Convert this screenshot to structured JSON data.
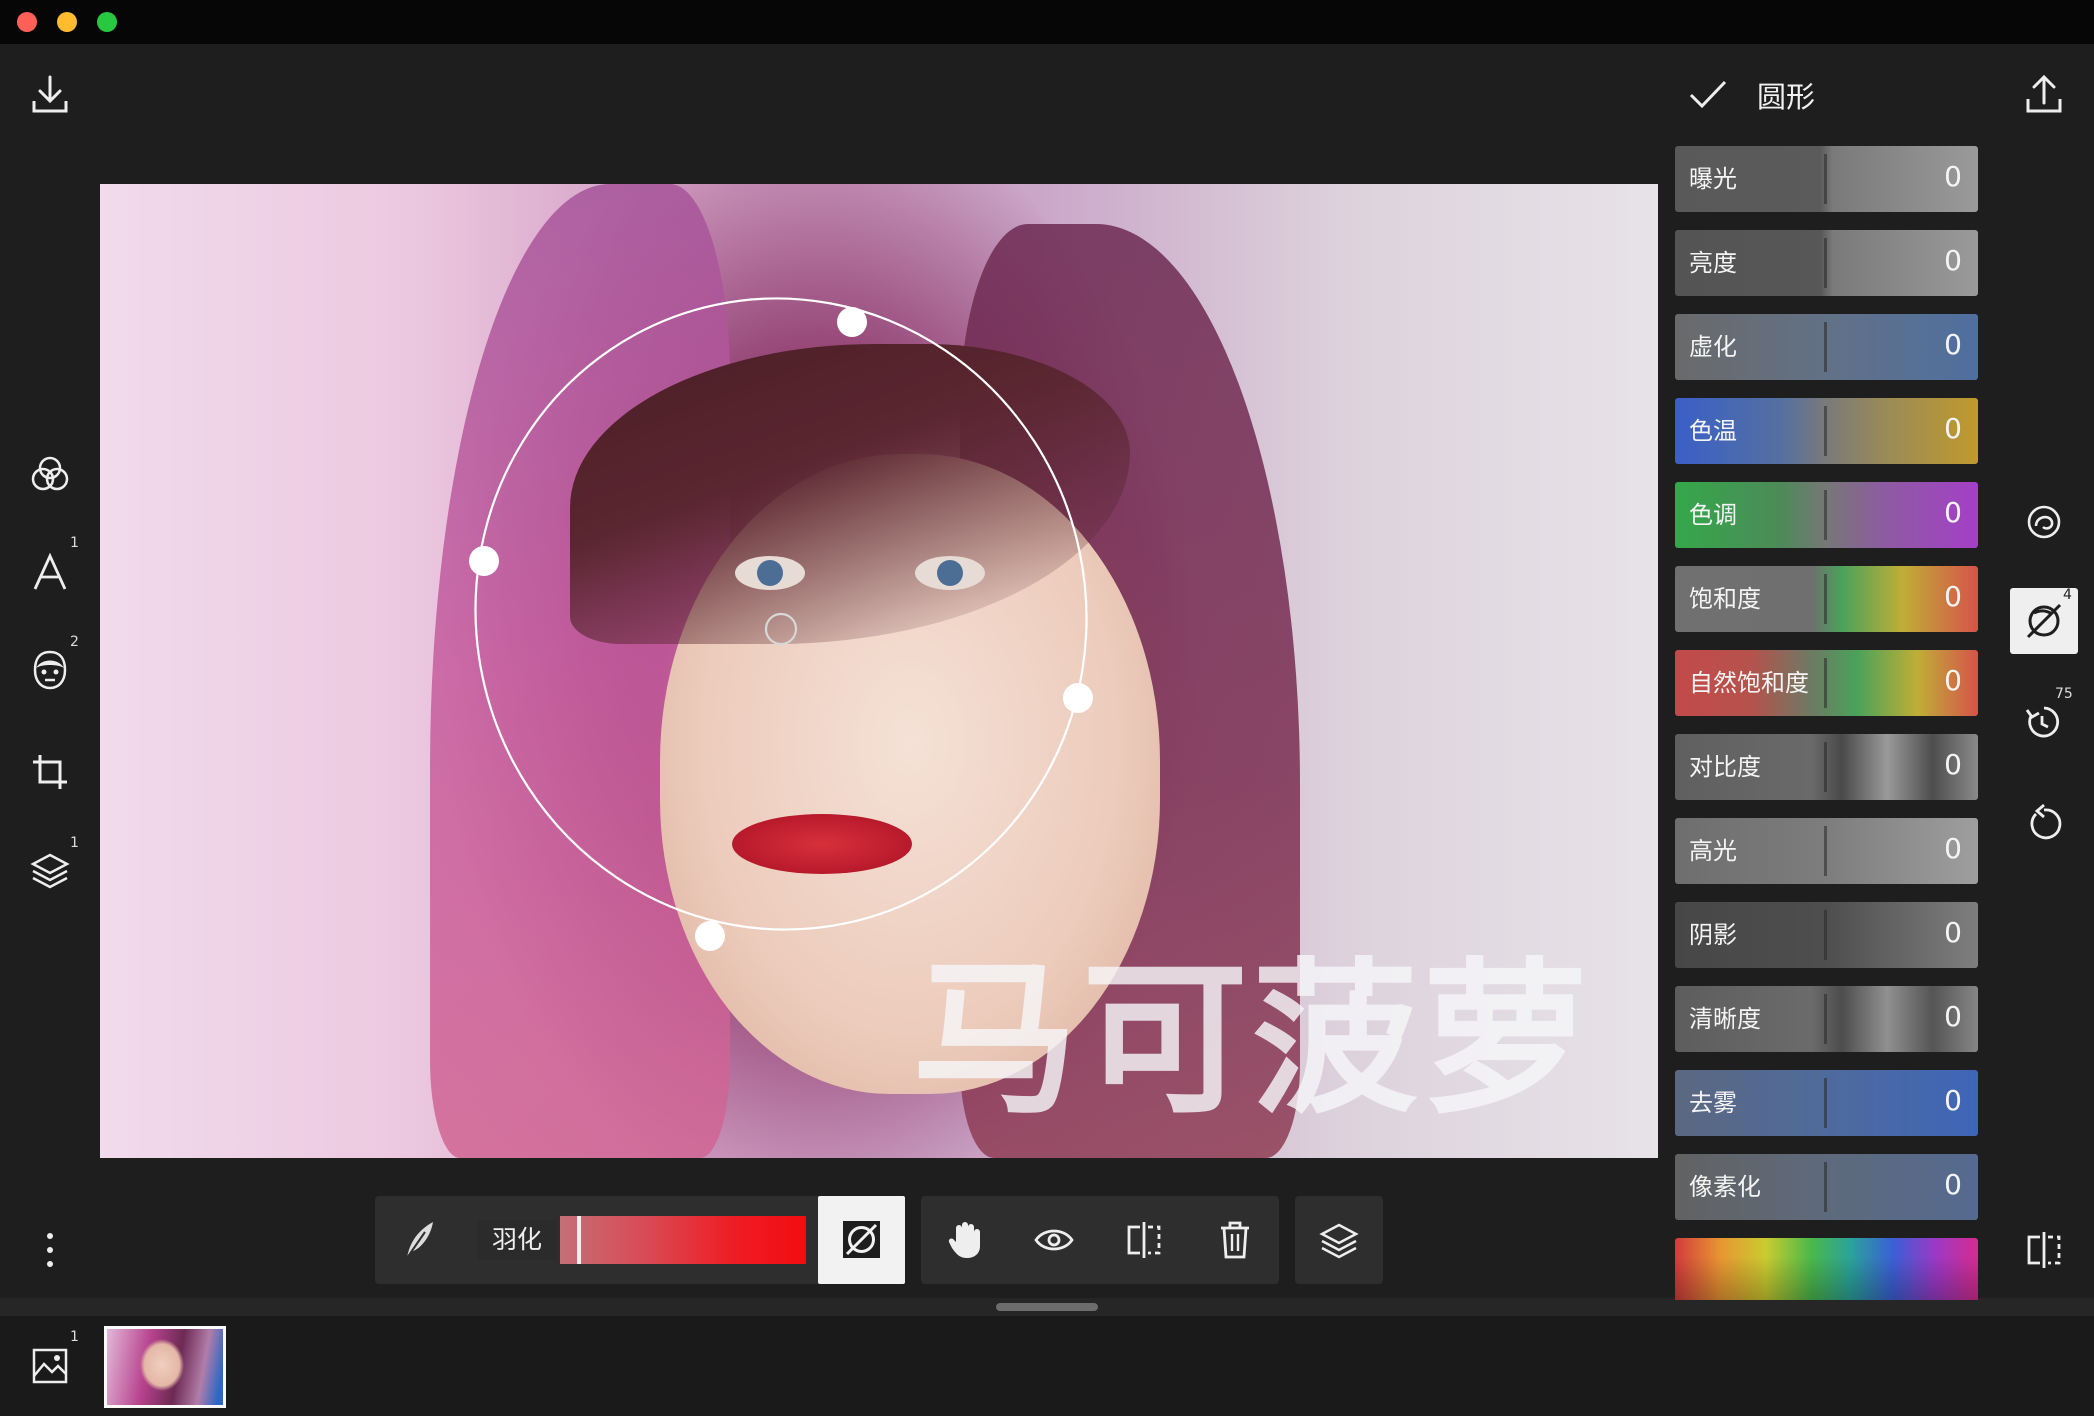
{
  "header": {
    "tool_title": "圆形"
  },
  "left_toolbar": {
    "badges": {
      "text": "1",
      "face": "2",
      "layers": "1"
    }
  },
  "canvas": {
    "watermark": "马可菠萝"
  },
  "bottom_toolbar": {
    "feather_label": "羽化",
    "feather_value_fraction": 0.07
  },
  "filmstrip": {
    "image_count_badge": "1"
  },
  "adjustments": [
    {
      "label": "曝光",
      "value": "0",
      "gradient": "linear-gradient(90deg,#595959 0%,#5b5b5b 48%,#7a7a7a 52%,#9a9a9a 100%)"
    },
    {
      "label": "亮度",
      "value": "0",
      "gradient": "linear-gradient(90deg,#545454 0%,#575757 48%,#7a7a7a 52%,#9a9a9a 100%)"
    },
    {
      "label": "虚化",
      "value": "0",
      "gradient": "linear-gradient(90deg,#6a6a6a 0%,#627186 50%,#4f6fa0 100%)"
    },
    {
      "label": "色温",
      "value": "0",
      "gradient": "linear-gradient(90deg,#3a5fc7 0%,#5470a0 35%,#7a7a7a 50%,#9b8b57 70%,#c09a2c 100%)"
    },
    {
      "label": "色调",
      "value": "0",
      "gradient": "linear-gradient(90deg,#34a84a 0%,#4d8a58 35%,#777777 50%,#8e5aa3 70%,#a43fc7 100%)"
    },
    {
      "label": "饱和度",
      "value": "0",
      "gradient": "linear-gradient(90deg,#707070 0%,#6f6f6f 45%,#4aa25a 55%,#bfae36 75%,#d6534a 100%)"
    },
    {
      "label": "自然饱和度",
      "value": "0",
      "gradient": "linear-gradient(90deg,#c34a4a 0%,#b5524c 25%,#6d7a64 45%,#4aa25a 60%,#bfae36 80%,#d6534a 100%)"
    },
    {
      "label": "对比度",
      "value": "0",
      "gradient": "linear-gradient(90deg,#5f5f5f 0%,#6a6a6a 45%,#4a4a4a 55%,#9a9a9a 70%,#4e4e4e 85%,#8a8a8a 100%)"
    },
    {
      "label": "高光",
      "value": "0",
      "gradient": "linear-gradient(90deg,#6e6e6e 0%,#7d7d7d 50%,#9e9e9e 100%)"
    },
    {
      "label": "阴影",
      "value": "0",
      "gradient": "linear-gradient(90deg,#474747 0%,#4e4e4e 50%,#7e7e7e 100%)"
    },
    {
      "label": "清晰度",
      "value": "0",
      "gradient": "linear-gradient(90deg,#5d5d5d 0%,#6b6b6b 45%,#4d4d4d 55%,#909090 70%,#555555 85%,#868686 100%)"
    },
    {
      "label": "去雾",
      "value": "0",
      "gradient": "linear-gradient(90deg,#5b6880 0%,#4f6a9c 50%,#3e66b8 100%)"
    },
    {
      "label": "像素化",
      "value": "0",
      "gradient": "linear-gradient(90deg,#626262 0%,#5e6a7c 50%,#556a90 100%)"
    }
  ],
  "right_rail": {
    "badges": {
      "masks": "4",
      "history": "75"
    }
  },
  "colors": {
    "background": "#1e1e1e",
    "titlebar": "#060606",
    "feather_accent": "#ee1d24"
  }
}
